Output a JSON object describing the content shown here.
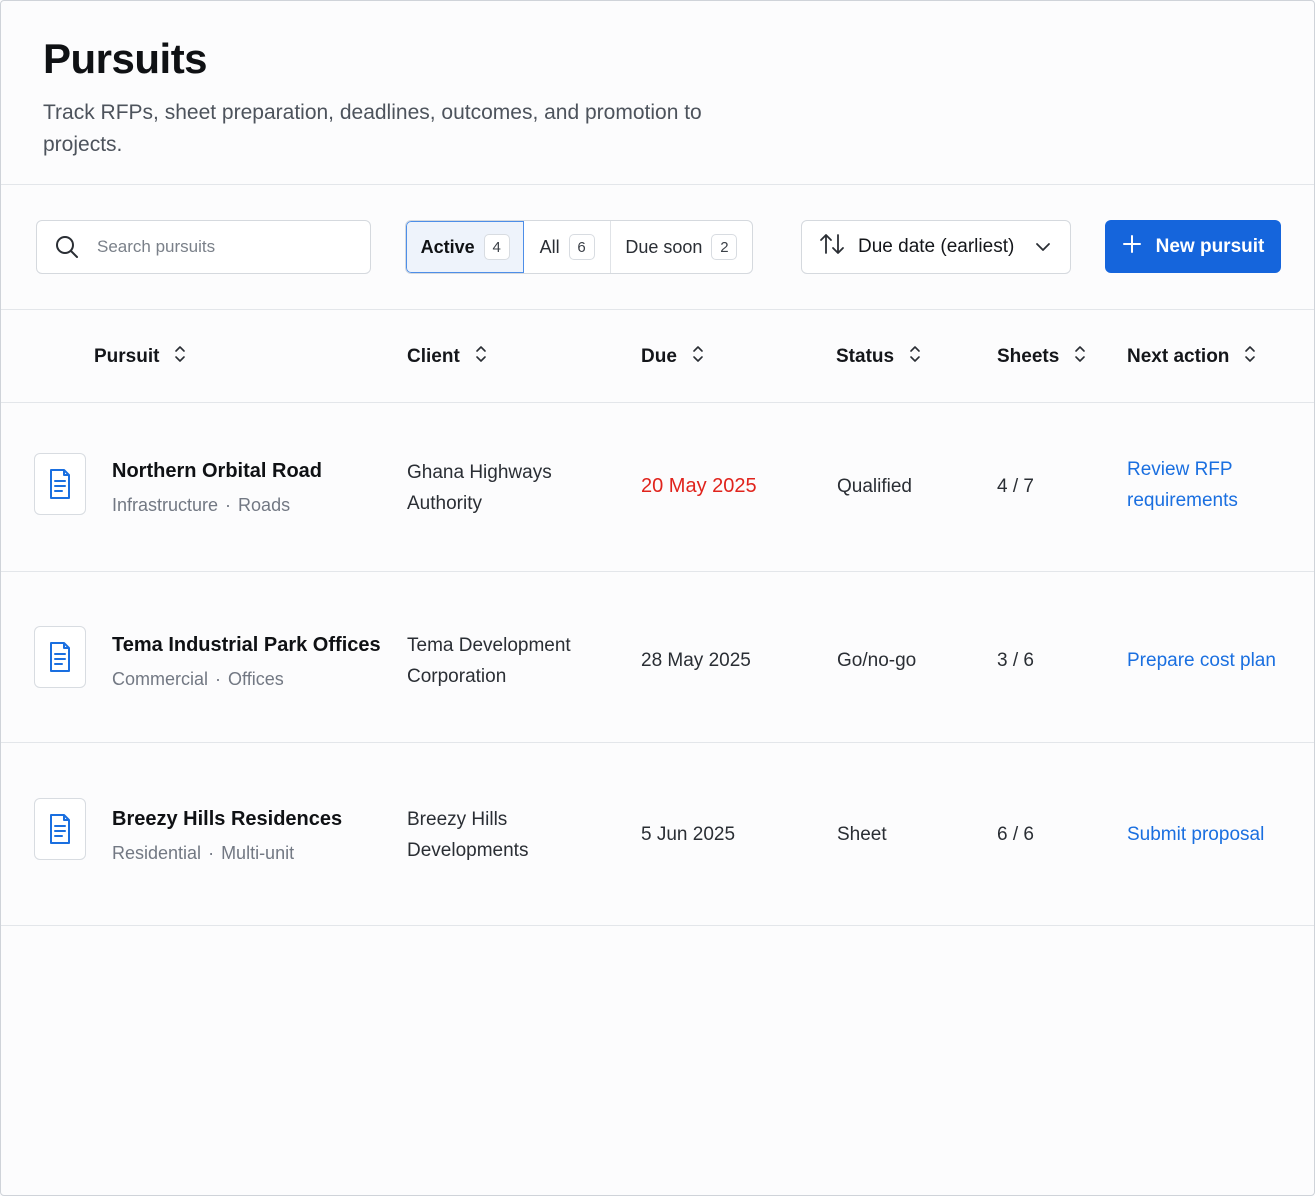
{
  "header": {
    "title": "Pursuits",
    "subtitle": "Track RFPs, sheet preparation, deadlines, outcomes, and promotion to projects."
  },
  "toolbar": {
    "search_placeholder": "Search pursuits",
    "filters": [
      {
        "label": "Active",
        "count": "4",
        "selected": true
      },
      {
        "label": "All",
        "count": "6",
        "selected": false
      },
      {
        "label": "Due soon",
        "count": "2",
        "selected": false
      }
    ],
    "sort_label": "Due date (earliest)",
    "new_button_label": "New pursuit"
  },
  "table": {
    "columns": [
      "Pursuit",
      "Client",
      "Due",
      "Status",
      "Sheets",
      "Next action"
    ],
    "rows": [
      {
        "name": "Northern Orbital Road",
        "sector": "Infrastructure",
        "subsector": "Roads",
        "client_line1": "Ghana Highways",
        "client_line2": "Authority",
        "due": "20 May 2025",
        "status": "Qualified",
        "sheets": "4 / 7",
        "action_line1": "Review RFP",
        "action_line2": "requirements"
      },
      {
        "name": "Tema Industrial Park Offices",
        "sector": "Commercial",
        "subsector": "Offices",
        "client_line1": "Tema Development",
        "client_line2": "Corporation",
        "due": "28 May 2025",
        "status": "Go/no-go",
        "sheets": "3 / 6",
        "action_line1": "Prepare cost plan",
        "action_line2": ""
      },
      {
        "name": "Breezy Hills Residences",
        "sector": "Residential",
        "subsector": "Multi-unit",
        "client_line1": "Breezy Hills",
        "client_line2": "Developments",
        "due": "5 Jun 2025",
        "status": "Sheet",
        "sheets": "6 / 6",
        "action_line1": "Submit proposal",
        "action_line2": ""
      }
    ],
    "separator": "·"
  },
  "colors": {
    "accent": "#1565dc",
    "overdue": "#e0231c",
    "link": "#1a6fe0"
  }
}
